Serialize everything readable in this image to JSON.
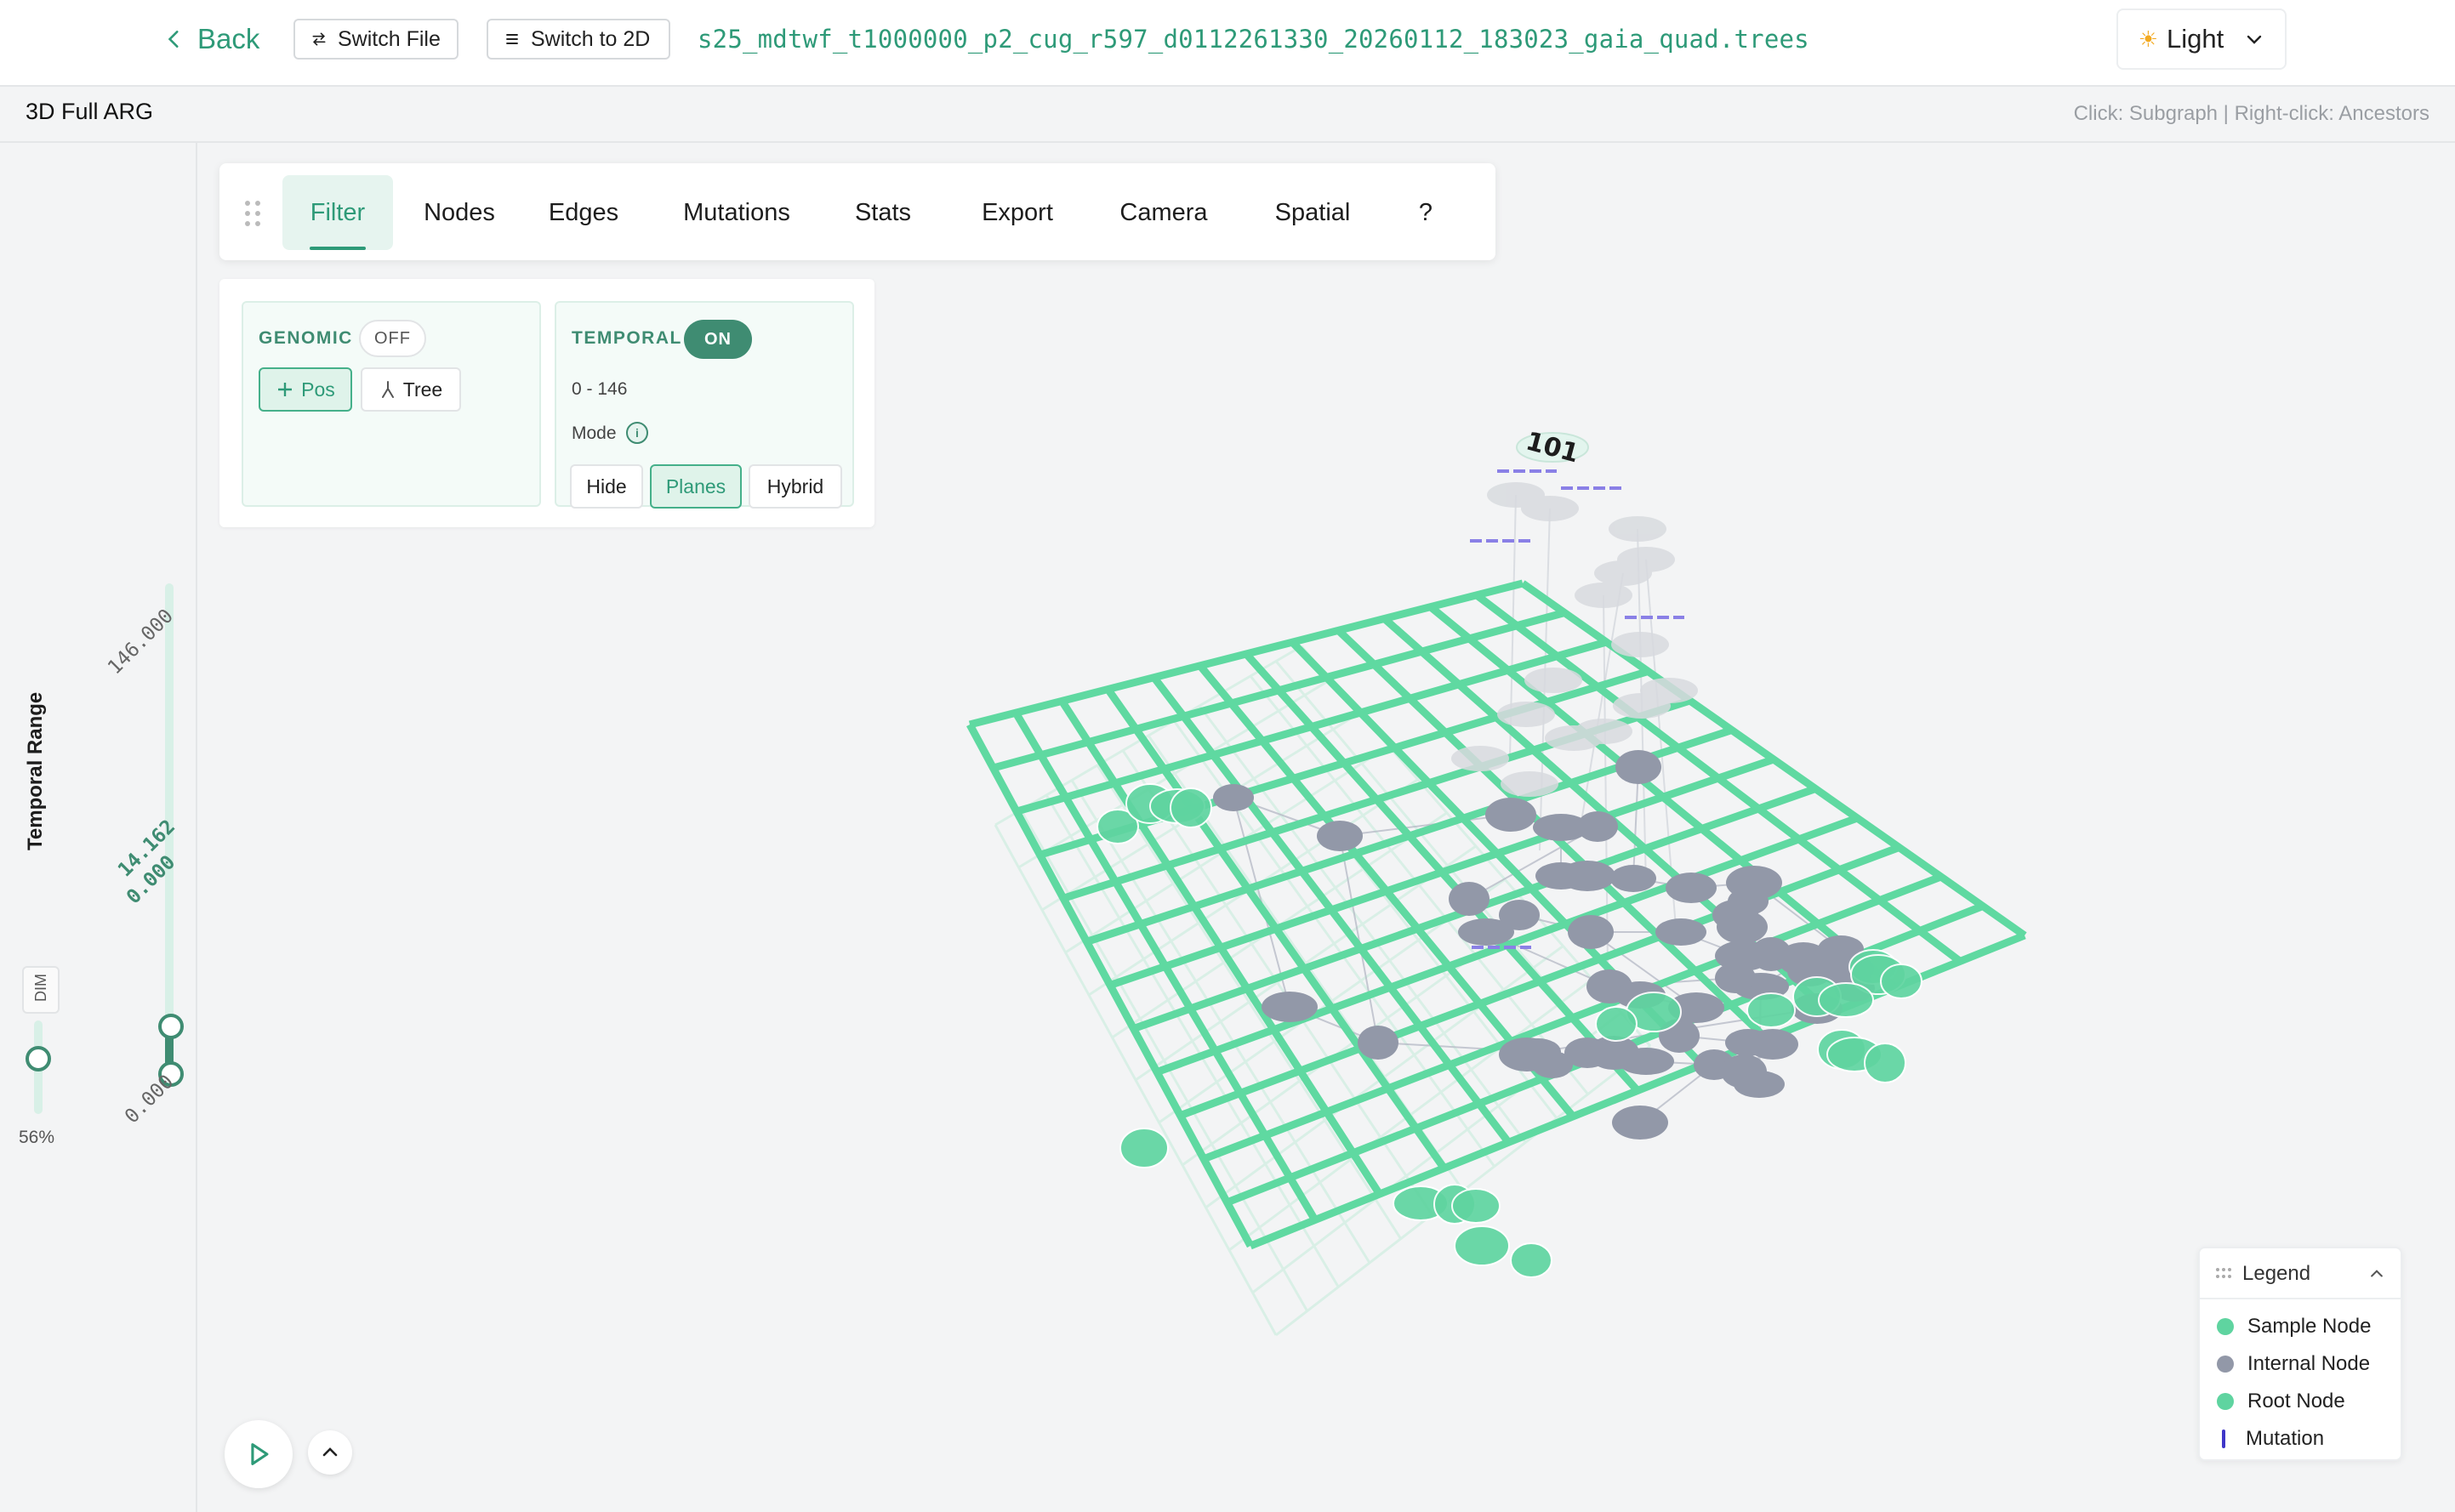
{
  "header": {
    "back_label": "Back",
    "switch_file_label": "Switch File",
    "switch_2d_label": "Switch to 2D",
    "file_name": "s25_mdtwf_t1000000_p2_cug_r597_d0112261330_20260112_183023_gaia_quad.trees",
    "theme_label": "Light"
  },
  "subheader": {
    "title": "3D Full ARG",
    "hint": "Click: Subgraph | Right-click: Ancestors"
  },
  "left_panel": {
    "temporal_range_label": "Temporal Range",
    "dim_label": "DIM",
    "dim_percent": "56%",
    "dim_value": 0.56,
    "range_max": "146.000",
    "range_current_top": "14.162",
    "range_current_bottom": "0.000",
    "range_min": "0.000"
  },
  "tabs": [
    "Filter",
    "Nodes",
    "Edges",
    "Mutations",
    "Stats",
    "Export",
    "Camera",
    "Spatial",
    "?"
  ],
  "active_tab": "Filter",
  "filter": {
    "genomic": {
      "title": "GENOMIC",
      "state": "OFF",
      "pos_label": "Pos",
      "tree_label": "Tree"
    },
    "temporal": {
      "title": "TEMPORAL",
      "state": "ON",
      "range": "0 - 146",
      "mode_label": "Mode",
      "modes": [
        "Hide",
        "Planes",
        "Hybrid"
      ],
      "selected_mode": "Planes"
    }
  },
  "viewport": {
    "root_label": "101"
  },
  "legend": {
    "title": "Legend",
    "items": [
      {
        "label": "Sample Node",
        "color": "#5fd4a0"
      },
      {
        "label": "Internal Node",
        "color": "#9298a8"
      },
      {
        "label": "Root Node",
        "color": "#5fd4a0"
      },
      {
        "label": "Mutation",
        "color": "#3f36c8"
      }
    ]
  },
  "colors": {
    "accent": "#2e9a78",
    "grid": "#5fd9a1",
    "sample_node": "#5fd4a0",
    "internal_node": "#9298a8",
    "mutation": "#7b72e0"
  }
}
